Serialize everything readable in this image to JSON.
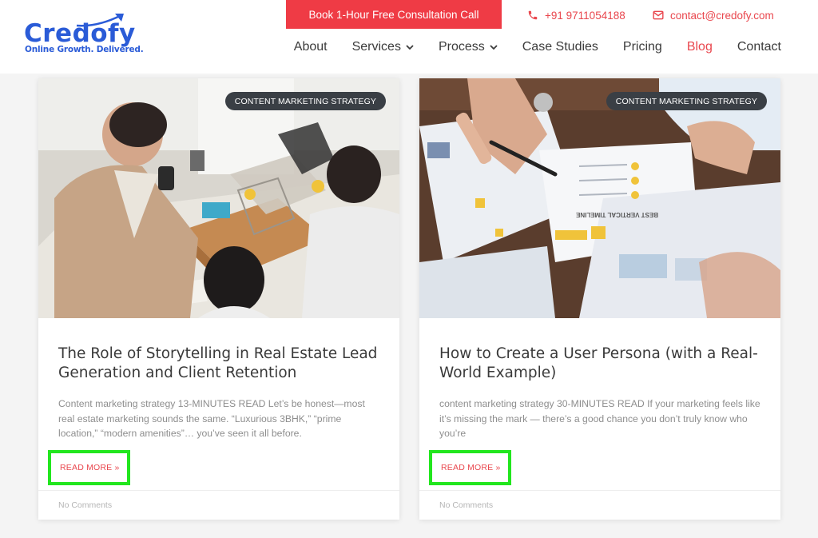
{
  "brand": {
    "name": "Credofy",
    "tagline": "Online Growth. Delivered.",
    "colors": {
      "primary": "#2a5bd7",
      "accent": "#ef3b45",
      "link": "#e9474e",
      "highlight": "#22e61e"
    }
  },
  "topbar": {
    "cta_label": "Book 1-Hour Free Consultation Call",
    "phone": "+91 9711054188",
    "email": "contact@credofy.com",
    "phone_icon": "phone-icon",
    "email_icon": "envelope-icon"
  },
  "nav": {
    "items": [
      {
        "label": "About",
        "dropdown": false,
        "active": false
      },
      {
        "label": "Services",
        "dropdown": true,
        "active": false
      },
      {
        "label": "Process",
        "dropdown": true,
        "active": false
      },
      {
        "label": "Case Studies",
        "dropdown": false,
        "active": false
      },
      {
        "label": "Pricing",
        "dropdown": false,
        "active": false
      },
      {
        "label": "Blog",
        "dropdown": false,
        "active": true
      },
      {
        "label": "Contact",
        "dropdown": false,
        "active": false
      }
    ]
  },
  "posts": [
    {
      "category": "CONTENT MARKETING STRATEGY",
      "title": "The Role of Storytelling in Real Estate Lead Generation and Client Retention",
      "excerpt": "Content marketing strategy 13-MINUTES READ Let’s be honest—most real estate marketing sounds the same. “Luxurious 3BHK,” “prime location,” “modern amenities”… you’ve seen it all before.",
      "read_more": "READ MORE »",
      "comments": "No Comments"
    },
    {
      "category": "CONTENT MARKETING STRATEGY",
      "title": "How to Create a User Persona (with a Real-World Example)",
      "excerpt": "content marketing strategy 30-MINUTES READ If your marketing feels like it’s missing the mark — there’s a good chance you don’t truly know who you’re",
      "read_more": "READ MORE »",
      "comments": "No Comments"
    }
  ],
  "image_text": {
    "timeline_heading": "BEST VERTICAL TIMELINE"
  }
}
